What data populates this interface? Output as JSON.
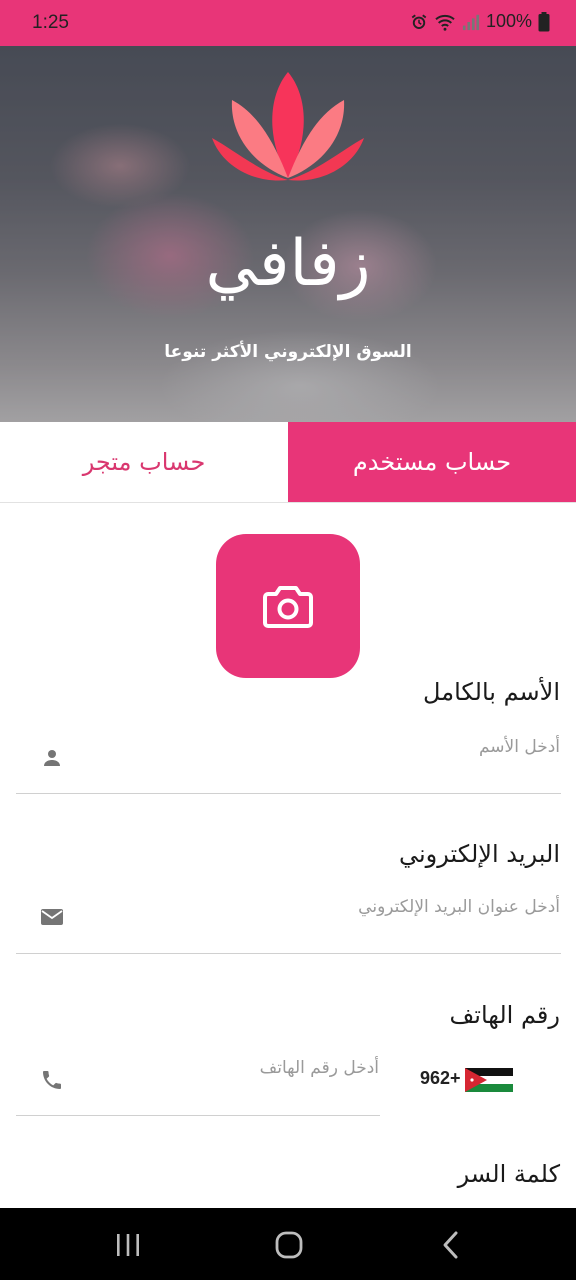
{
  "status_bar": {
    "time": "1:25",
    "battery": "100%",
    "icons": [
      "alarm-icon",
      "wifi-icon",
      "signal-icon",
      "battery-icon"
    ]
  },
  "hero": {
    "title": "زفافي",
    "subtitle": "السوق الإلكتروني الأكثر تنوعا",
    "logo": "lotus-logo"
  },
  "tabs": [
    {
      "label": "حساب متجر",
      "active": false
    },
    {
      "label": "حساب مستخدم",
      "active": true
    }
  ],
  "form": {
    "photo_icon": "camera-icon",
    "name": {
      "label": "الأسم بالكامل",
      "placeholder": "أدخل الأسم",
      "icon": "person-icon"
    },
    "email": {
      "label": "البريد الإلكتروني",
      "placeholder": "أدخل عنوان البريد الإلكتروني",
      "icon": "mail-icon"
    },
    "phone": {
      "label": "رقم الهاتف",
      "placeholder": "أدخل رقم الهاتف",
      "icon": "phone-icon",
      "country_code": "962+",
      "flag": "jordan-flag"
    },
    "password": {
      "label": "كلمة السر"
    }
  },
  "nav_bar": {
    "buttons": [
      "recents-icon",
      "home-icon",
      "back-icon"
    ]
  },
  "colors": {
    "accent": "#e83578",
    "tab_inactive_text": "#d9376f",
    "nav_bg": "#000000"
  }
}
